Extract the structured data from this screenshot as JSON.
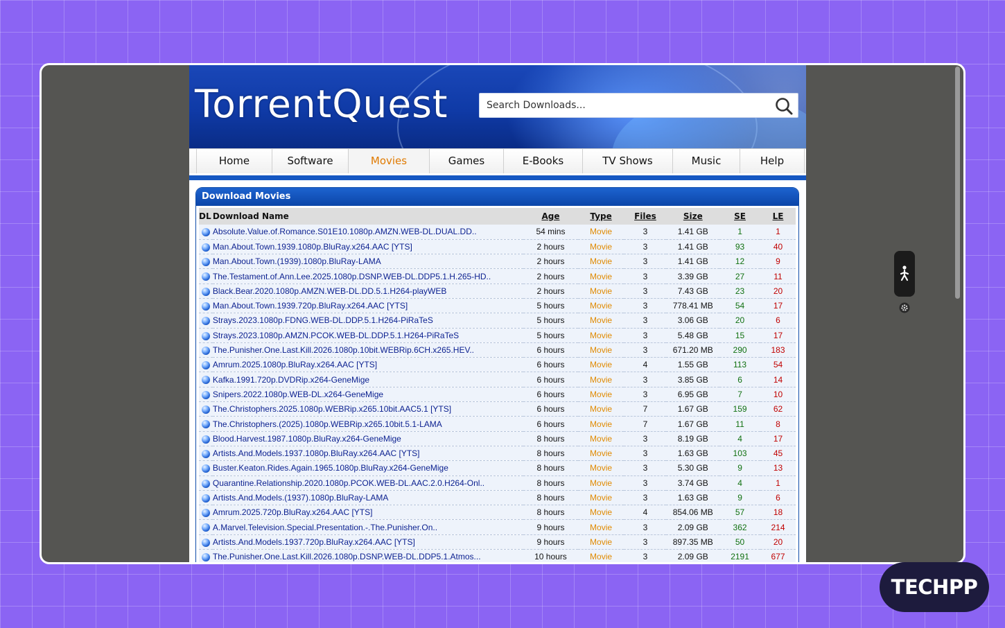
{
  "site": {
    "logo": "TorrentQuest"
  },
  "search": {
    "placeholder": "Search Downloads..."
  },
  "nav": [
    {
      "label": "Home",
      "active": false
    },
    {
      "label": "Software",
      "active": false
    },
    {
      "label": "Movies",
      "active": true
    },
    {
      "label": "Games",
      "active": false
    },
    {
      "label": "E-Books",
      "active": false
    },
    {
      "label": "TV Shows",
      "active": false
    },
    {
      "label": "Music",
      "active": false
    },
    {
      "label": "Help",
      "active": false
    }
  ],
  "panel": {
    "title": "Download Movies"
  },
  "table": {
    "headers": {
      "dl": "DL",
      "name": "Download Name",
      "age": "Age",
      "type": "Type",
      "files": "Files",
      "size": "Size",
      "se": "SE",
      "le": "LE"
    },
    "rows": [
      {
        "name": "Absolute.Value.of.Romance.S01E10.1080p.AMZN.WEB-DL.DUAL.DD..",
        "age": "54 mins",
        "type": "Movie",
        "files": "3",
        "size": "1.41 GB",
        "se": "1",
        "le": "1"
      },
      {
        "name": "Man.About.Town.1939.1080p.BluRay.x264.AAC [YTS]",
        "age": "2 hours",
        "type": "Movie",
        "files": "3",
        "size": "1.41 GB",
        "se": "93",
        "le": "40"
      },
      {
        "name": "Man.About.Town.(1939).1080p.BluRay-LAMA",
        "age": "2 hours",
        "type": "Movie",
        "files": "3",
        "size": "1.41 GB",
        "se": "12",
        "le": "9"
      },
      {
        "name": "The.Testament.of.Ann.Lee.2025.1080p.DSNP.WEB-DL.DDP5.1.H.265-HD..",
        "age": "2 hours",
        "type": "Movie",
        "files": "3",
        "size": "3.39 GB",
        "se": "27",
        "le": "11"
      },
      {
        "name": "Black.Bear.2020.1080p.AMZN.WEB-DL.DD.5.1.H264-playWEB",
        "age": "2 hours",
        "type": "Movie",
        "files": "3",
        "size": "7.43 GB",
        "se": "23",
        "le": "20"
      },
      {
        "name": "Man.About.Town.1939.720p.BluRay.x264.AAC [YTS]",
        "age": "5 hours",
        "type": "Movie",
        "files": "3",
        "size": "778.41 MB",
        "se": "54",
        "le": "17"
      },
      {
        "name": "Strays.2023.1080p.FDNG.WEB-DL.DDP.5.1.H264-PiRaTeS",
        "age": "5 hours",
        "type": "Movie",
        "files": "3",
        "size": "3.06 GB",
        "se": "20",
        "le": "6"
      },
      {
        "name": "Strays.2023.1080p.AMZN.PCOK.WEB-DL.DDP.5.1.H264-PiRaTeS",
        "age": "5 hours",
        "type": "Movie",
        "files": "3",
        "size": "5.48 GB",
        "se": "15",
        "le": "17"
      },
      {
        "name": "The.Punisher.One.Last.Kill.2026.1080p.10bit.WEBRip.6CH.x265.HEV..",
        "age": "6 hours",
        "type": "Movie",
        "files": "3",
        "size": "671.20 MB",
        "se": "290",
        "le": "183"
      },
      {
        "name": "Amrum.2025.1080p.BluRay.x264.AAC [YTS]",
        "age": "6 hours",
        "type": "Movie",
        "files": "4",
        "size": "1.55 GB",
        "se": "113",
        "le": "54"
      },
      {
        "name": "Kafka.1991.720p.DVDRip.x264-GeneMige",
        "age": "6 hours",
        "type": "Movie",
        "files": "3",
        "size": "3.85 GB",
        "se": "6",
        "le": "14"
      },
      {
        "name": "Snipers.2022.1080p.WEB-DL.x264-GeneMige",
        "age": "6 hours",
        "type": "Movie",
        "files": "3",
        "size": "6.95 GB",
        "se": "7",
        "le": "10"
      },
      {
        "name": "The.Christophers.2025.1080p.WEBRip.x265.10bit.AAC5.1 [YTS]",
        "age": "6 hours",
        "type": "Movie",
        "files": "7",
        "size": "1.67 GB",
        "se": "159",
        "le": "62"
      },
      {
        "name": "The.Christophers.(2025).1080p.WEBRip.x265.10bit.5.1-LAMA",
        "age": "6 hours",
        "type": "Movie",
        "files": "7",
        "size": "1.67 GB",
        "se": "11",
        "le": "8"
      },
      {
        "name": "Blood.Harvest.1987.1080p.BluRay.x264-GeneMige",
        "age": "8 hours",
        "type": "Movie",
        "files": "3",
        "size": "8.19 GB",
        "se": "4",
        "le": "17"
      },
      {
        "name": "Artists.And.Models.1937.1080p.BluRay.x264.AAC [YTS]",
        "age": "8 hours",
        "type": "Movie",
        "files": "3",
        "size": "1.63 GB",
        "se": "103",
        "le": "45"
      },
      {
        "name": "Buster.Keaton.Rides.Again.1965.1080p.BluRay.x264-GeneMige",
        "age": "8 hours",
        "type": "Movie",
        "files": "3",
        "size": "5.30 GB",
        "se": "9",
        "le": "13"
      },
      {
        "name": "Quarantine.Relationship.2020.1080p.PCOK.WEB-DL.AAC.2.0.H264-Onl..",
        "age": "8 hours",
        "type": "Movie",
        "files": "3",
        "size": "3.74 GB",
        "se": "4",
        "le": "1"
      },
      {
        "name": "Artists.And.Models.(1937).1080p.BluRay-LAMA",
        "age": "8 hours",
        "type": "Movie",
        "files": "3",
        "size": "1.63 GB",
        "se": "9",
        "le": "6"
      },
      {
        "name": "Amrum.2025.720p.BluRay.x264.AAC [YTS]",
        "age": "8 hours",
        "type": "Movie",
        "files": "4",
        "size": "854.06 MB",
        "se": "57",
        "le": "18"
      },
      {
        "name": "A.Marvel.Television.Special.Presentation.-.The.Punisher.On..",
        "age": "9 hours",
        "type": "Movie",
        "files": "3",
        "size": "2.09 GB",
        "se": "362",
        "le": "214"
      },
      {
        "name": "Artists.And.Models.1937.720p.BluRay.x264.AAC [YTS]",
        "age": "9 hours",
        "type": "Movie",
        "files": "3",
        "size": "897.35 MB",
        "se": "50",
        "le": "20"
      },
      {
        "name": "The.Punisher.One.Last.Kill.2026.1080p.DSNP.WEB-DL.DDP5.1.Atmos...",
        "age": "10 hours",
        "type": "Movie",
        "files": "3",
        "size": "2.09 GB",
        "se": "2191",
        "le": "677"
      }
    ]
  },
  "badge": {
    "text": "TECHPP"
  },
  "icons": {
    "search": "search-icon",
    "globe": "globe-icon",
    "accessibility": "accessibility-icon",
    "settings": "gear-icon"
  },
  "colors": {
    "accent": "#e07a00",
    "link": "#0a1f8f",
    "seeders": "#107010",
    "leechers": "#c00000",
    "brand": "#0f3aa6"
  }
}
